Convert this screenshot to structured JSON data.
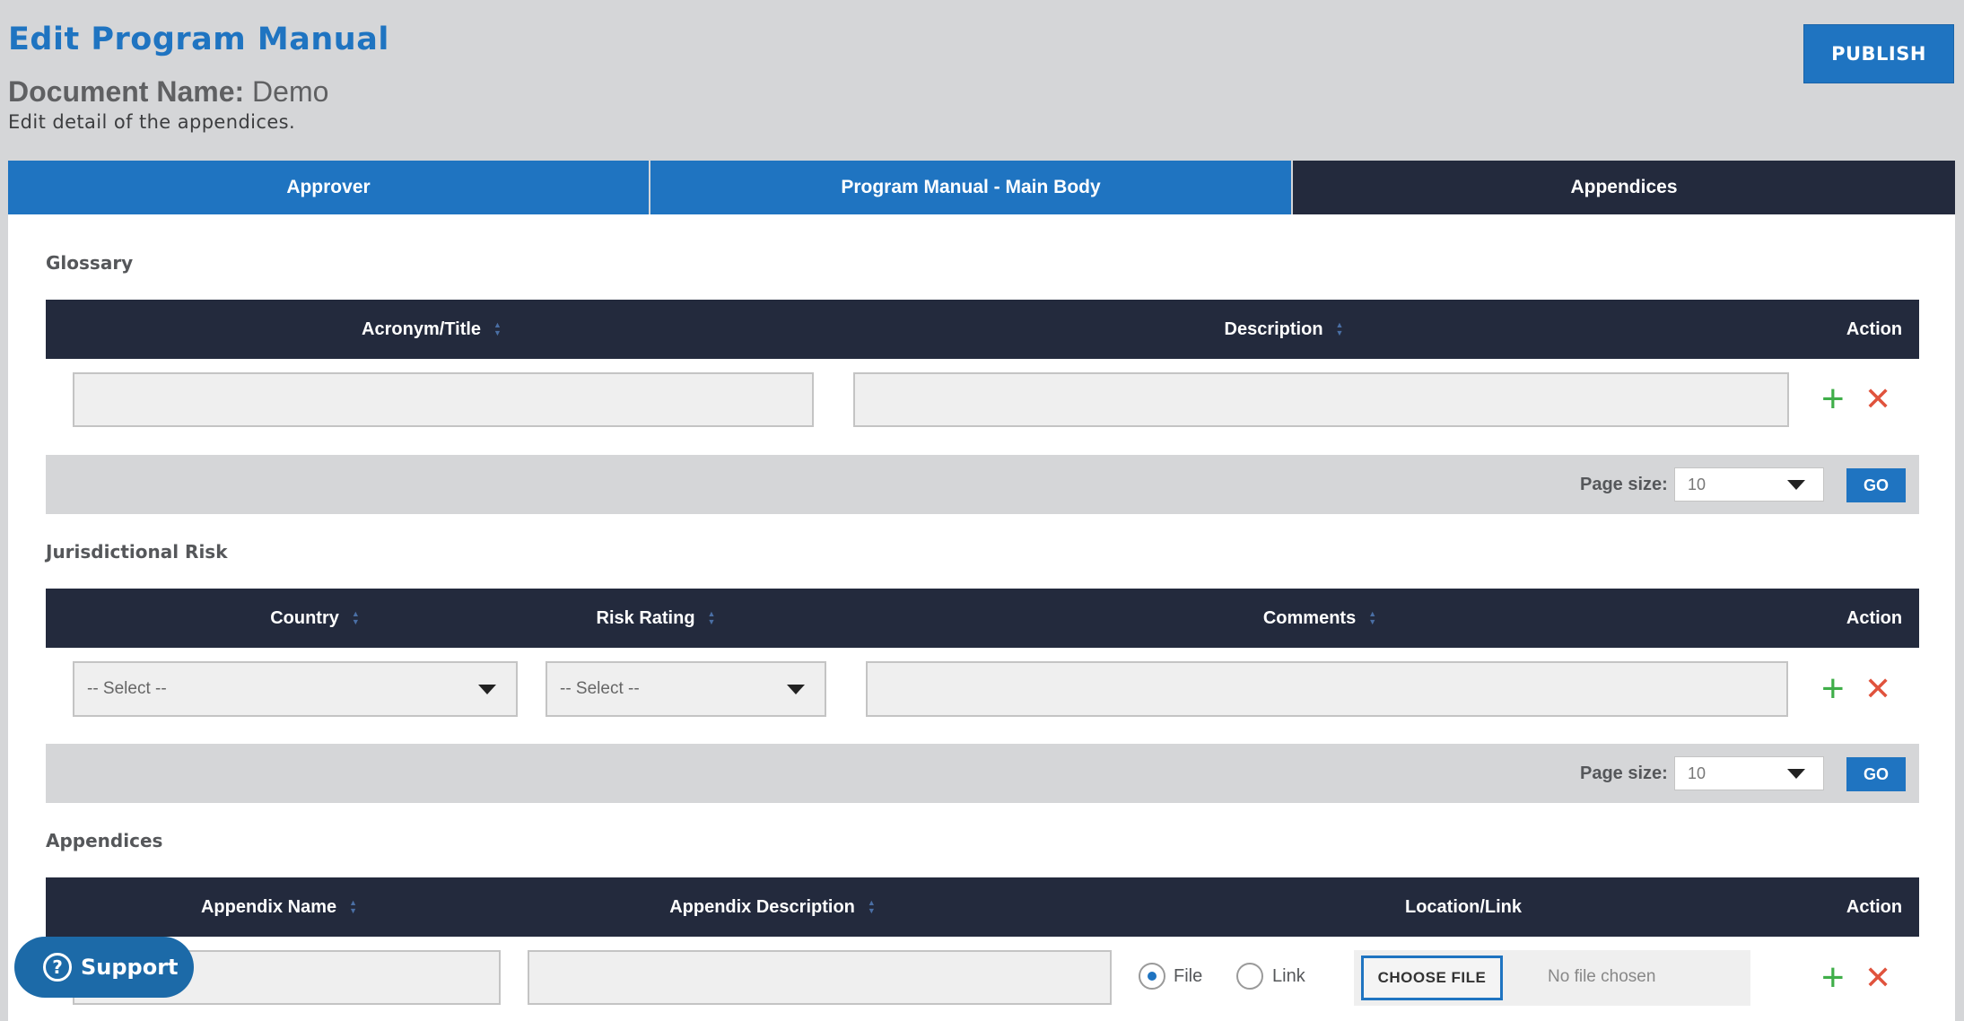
{
  "header": {
    "title": "Edit Program Manual",
    "doc_label": "Document Name:",
    "doc_value": "Demo",
    "subtitle": "Edit detail of the appendices.",
    "publish_label": "PUBLISH"
  },
  "tabs": [
    {
      "label": "Approver",
      "active": false
    },
    {
      "label": "Program Manual - Main Body",
      "active": false
    },
    {
      "label": "Appendices",
      "active": true
    }
  ],
  "glossary": {
    "title": "Glossary",
    "columns": [
      "Acronym/Title",
      "Description",
      "Action"
    ],
    "pager": {
      "label": "Page size:",
      "value": "10",
      "go": "GO"
    }
  },
  "jurisdictional": {
    "title": "Jurisdictional Risk",
    "columns": [
      "Country",
      "Risk Rating",
      "Comments",
      "Action"
    ],
    "country_select": "-- Select --",
    "rating_select": "-- Select --",
    "pager": {
      "label": "Page size:",
      "value": "10",
      "go": "GO"
    }
  },
  "appendices": {
    "title": "Appendices",
    "columns": [
      "Appendix Name",
      "Appendix Description",
      "Location/Link",
      "Action"
    ],
    "radio_file": "File",
    "radio_link": "Link",
    "choose_file": "CHOOSE FILE",
    "no_file": "No file chosen"
  },
  "support": {
    "label": "Support",
    "icon": "?"
  },
  "icons": {
    "add": "+",
    "remove": "✕",
    "sort": [
      "▲",
      "▼"
    ]
  },
  "colors": {
    "accent": "#1f74c1",
    "dark": "#232a3d",
    "add": "#3fae49",
    "remove": "#e0533d"
  }
}
